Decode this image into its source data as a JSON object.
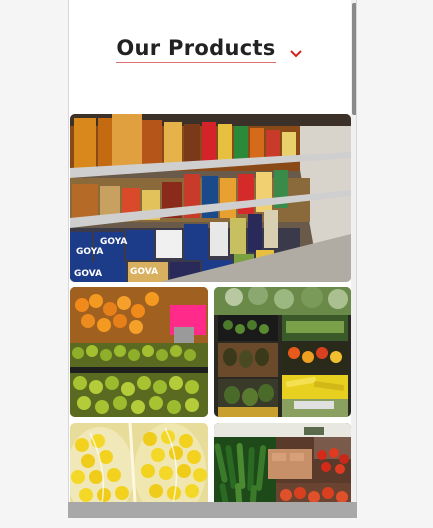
{
  "section": {
    "title": "Our Products"
  },
  "gallery": {
    "images": [
      {
        "subject": "grocery aisle shelves with canned goods"
      },
      {
        "subject": "oranges and limes produce bins"
      },
      {
        "subject": "vegetables produce display"
      },
      {
        "subject": "bagged lemons"
      },
      {
        "subject": "cucumbers and tomatoes"
      }
    ]
  },
  "icons": {
    "expand": "chevron-down-icon"
  },
  "colors": {
    "title": "#222222",
    "accent": "#d0261e"
  }
}
